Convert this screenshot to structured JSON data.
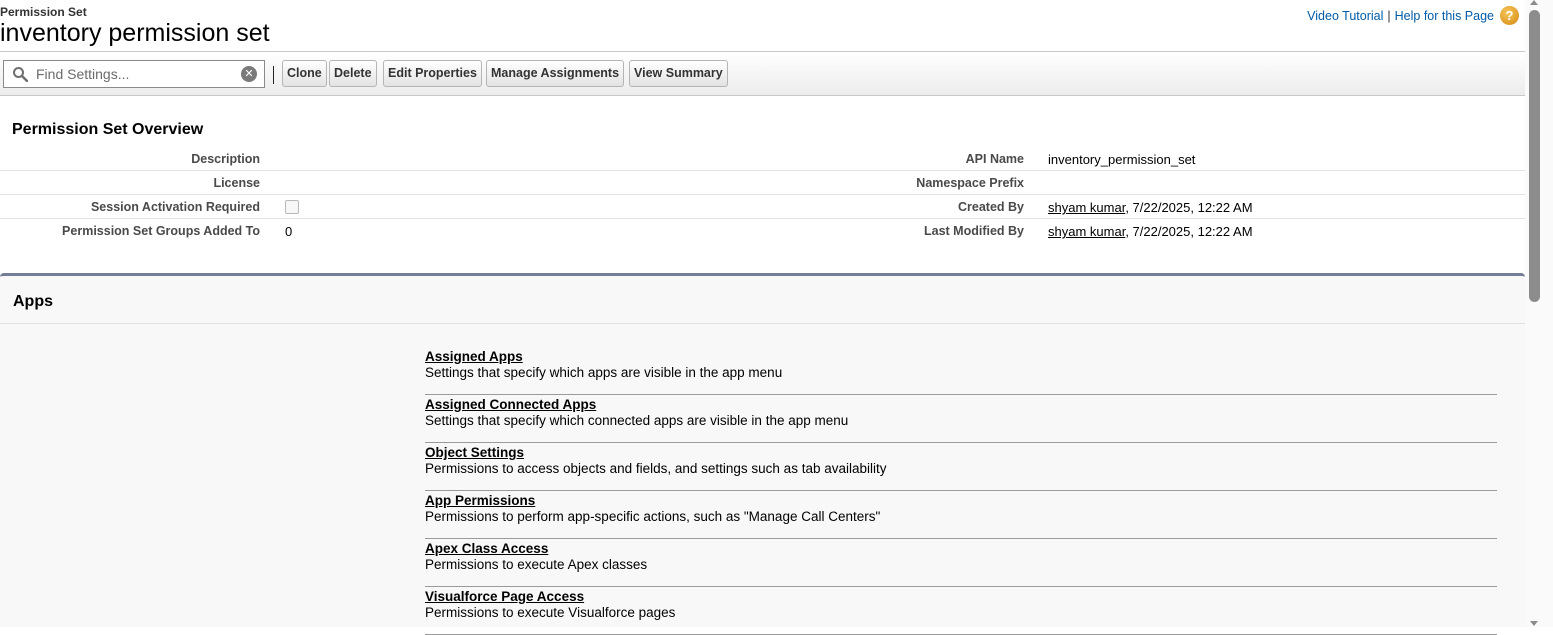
{
  "header": {
    "type_label": "Permission Set",
    "title": "inventory permission set",
    "video_tutorial": "Video Tutorial",
    "separator": "|",
    "help_link": "Help for this Page",
    "help_icon": "?"
  },
  "toolbar": {
    "search_placeholder": "Find Settings...",
    "clone": "Clone",
    "delete": "Delete",
    "edit_properties": "Edit Properties",
    "manage_assignments": "Manage Assignments",
    "view_summary": "View Summary"
  },
  "overview": {
    "title": "Permission Set Overview",
    "description_label": "Description",
    "description_value": "",
    "license_label": "License",
    "license_value": "",
    "session_label": "Session Activation Required",
    "session_checked": false,
    "groups_label": "Permission Set Groups Added To",
    "groups_value": "0",
    "api_name_label": "API Name",
    "api_name_value": "inventory_permission_set",
    "namespace_label": "Namespace Prefix",
    "namespace_value": "",
    "created_by_label": "Created By",
    "created_by_user": "shyam kumar",
    "created_by_date": ", 7/22/2025, 12:22 AM",
    "modified_by_label": "Last Modified By",
    "modified_by_user": "shyam kumar",
    "modified_by_date": ", 7/22/2025, 12:22 AM"
  },
  "apps": {
    "title": "Apps",
    "items": [
      {
        "label": "Assigned Apps",
        "desc": "Settings that specify which apps are visible in the app menu"
      },
      {
        "label": "Assigned Connected Apps",
        "desc": "Settings that specify which connected apps are visible in the app menu"
      },
      {
        "label": "Object Settings",
        "desc": "Permissions to access objects and fields, and settings such as tab availability"
      },
      {
        "label": "App Permissions",
        "desc": "Permissions to perform app-specific actions, such as \"Manage Call Centers\""
      },
      {
        "label": "Apex Class Access",
        "desc": "Permissions to execute Apex classes"
      },
      {
        "label": "Visualforce Page Access",
        "desc": "Permissions to execute Visualforce pages"
      }
    ]
  }
}
